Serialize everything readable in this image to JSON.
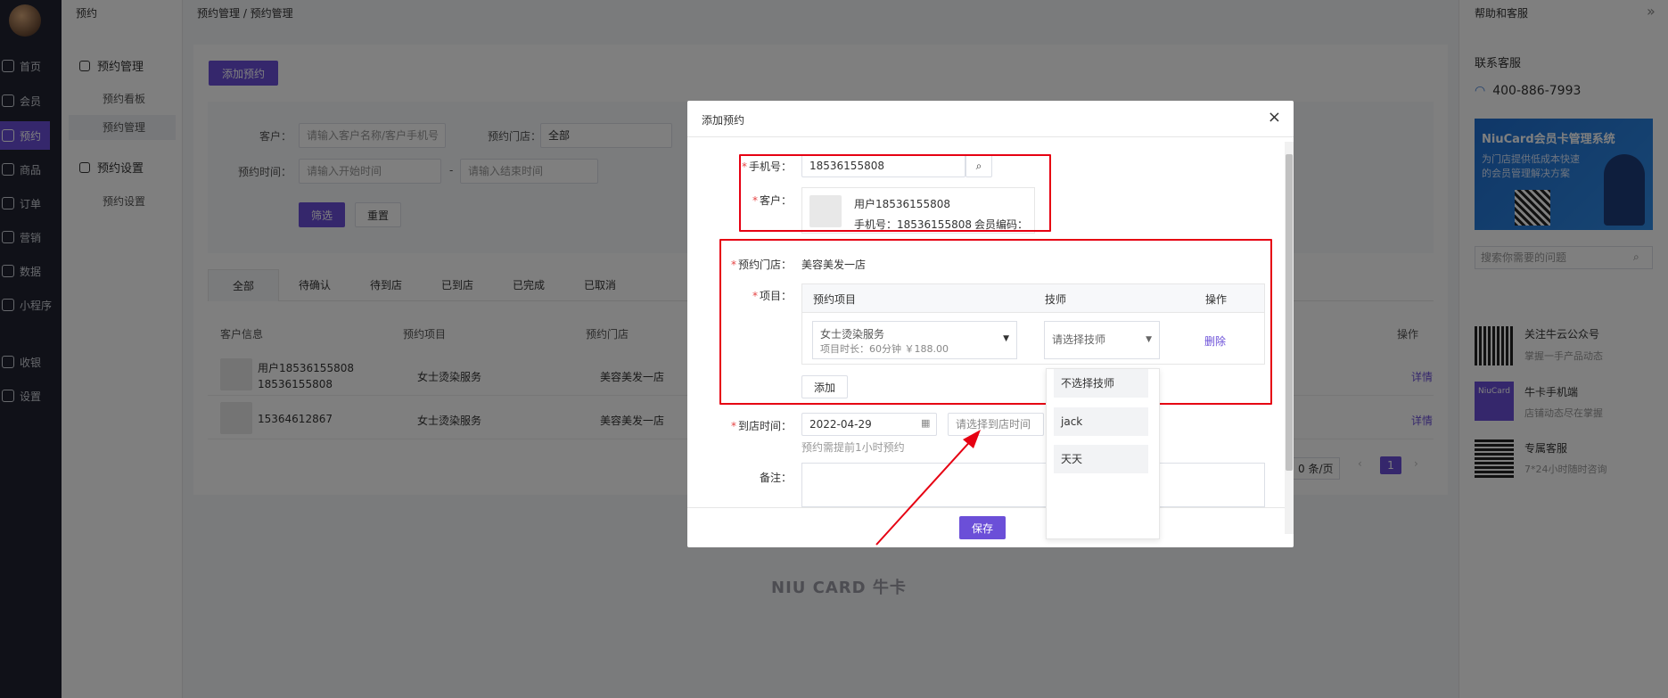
{
  "nav": {
    "items": [
      {
        "label": "首页",
        "icon": "home-icon"
      },
      {
        "label": "会员",
        "icon": "user-icon"
      },
      {
        "label": "预约",
        "icon": "calendar-icon"
      },
      {
        "label": "商品",
        "icon": "shop-icon"
      },
      {
        "label": "订单",
        "icon": "order-icon"
      },
      {
        "label": "营销",
        "icon": "marketing-icon"
      },
      {
        "label": "数据",
        "icon": "chart-icon"
      },
      {
        "label": "小程序",
        "icon": "miniapp-icon"
      },
      {
        "label": "收银",
        "icon": "cashier-icon"
      },
      {
        "label": "设置",
        "icon": "gear-icon"
      }
    ]
  },
  "subnav": {
    "header": "预约",
    "group1": "预约管理",
    "item1": "预约看板",
    "item2": "预约管理",
    "group2": "预约设置",
    "item3": "预约设置"
  },
  "breadcrumb": "预约管理 / 预约管理",
  "main": {
    "add_button": "添加预约",
    "filter": {
      "customer_label": "客户：",
      "customer_placeholder": "请输入客户名称/客户手机号",
      "store_label": "预约门店：",
      "store_value": "全部",
      "time_label": "预约时间：",
      "start_placeholder": "请输入开始时间",
      "range_sep": "-",
      "end_placeholder": "请输入结束时间",
      "filter_button": "筛选",
      "reset_button": "重置"
    },
    "tabs": [
      "全部",
      "待确认",
      "待到店",
      "已到店",
      "已完成",
      "已取消"
    ],
    "table": {
      "headers": [
        "客户信息",
        "预约项目",
        "预约门店",
        "操作"
      ],
      "rows": [
        {
          "name": "用户18536155808",
          "phone": "18536155808",
          "project": "女士烫染服务",
          "store": "美容美发一店",
          "action": "详情"
        },
        {
          "name": "15364612867",
          "phone": "",
          "project": "女士烫染服务",
          "store": "美容美发一店",
          "action": "详情"
        }
      ]
    },
    "pagination": {
      "page_size": "0 条/页",
      "current_page": "1"
    },
    "watermark": "NIU CARD 牛卡"
  },
  "right_panel": {
    "header": "帮助和客服",
    "collapse": "»",
    "contact_title": "联系客服",
    "phone": "400-886-7993",
    "banner_title": "NiuCard会员卡管理系统",
    "banner_sub1": "为门店提供低成本快速",
    "banner_sub2": "的会员管理解决方案",
    "search_placeholder": "搜索你需要的问题",
    "items": [
      {
        "title": "关注牛云公众号",
        "sub": "掌握一手产品动态"
      },
      {
        "title": "牛卡手机端",
        "sub": "店铺动态尽在掌握"
      },
      {
        "title": "专属客服",
        "sub": "7*24小时随时咨询"
      }
    ],
    "niucard_badge": "NiuCard"
  },
  "modal": {
    "title": "添加预约",
    "close": "×",
    "phone_label": "手机号：",
    "phone_value": "18536155808",
    "customer_label": "客户：",
    "customer_name": "用户18536155808",
    "customer_phone": "手机号：18536155808",
    "customer_code": "会员编码：",
    "store_label": "预约门店：",
    "store_value": "美容美发一店",
    "project_label": "项目：",
    "project_headers": [
      "预约项目",
      "技师",
      "操作"
    ],
    "project_name": "女士烫染服务",
    "project_detail": "项目时长：60分钟 ￥188.00",
    "technician_placeholder": "请选择技师",
    "delete": "删除",
    "add_button": "添加",
    "arrival_label": "到店时间：",
    "arrival_date": "2022-04-29",
    "arrival_time_placeholder": "请选择到店时间",
    "arrival_hint": "预约需提前1小时预约",
    "remark_label": "备注：",
    "save_button": "保存",
    "required_mark": "*",
    "technician_options": [
      "不选择技师",
      "jack",
      "天天"
    ]
  },
  "colors": {
    "accent": "#6b4fd8",
    "annotation_red": "#e60012",
    "nav_bg": "#202330"
  }
}
